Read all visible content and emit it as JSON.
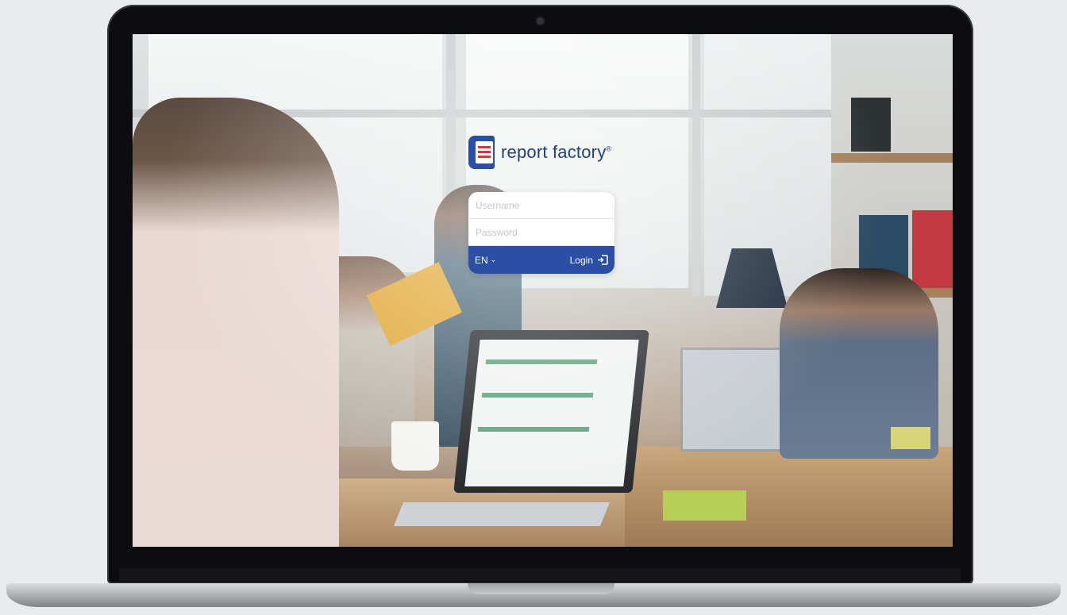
{
  "brand": {
    "name": "report factory",
    "registered": "®"
  },
  "login": {
    "username_placeholder": "Username",
    "username_value": "",
    "password_placeholder": "Password",
    "password_value": "",
    "language": "EN",
    "submit_label": "Login"
  },
  "colors": {
    "brand_blue": "#2a4fa3",
    "logo_red": "#d23a3a"
  },
  "icons": {
    "lang_chevron": "chevron-down-icon",
    "login": "sign-in-icon"
  }
}
